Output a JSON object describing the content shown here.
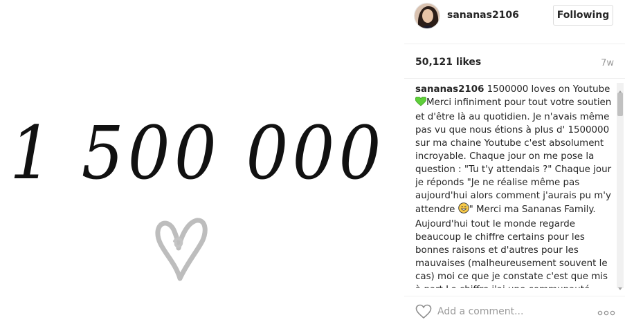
{
  "media": {
    "number_text": "1 500 000"
  },
  "header": {
    "username": "sananas2106",
    "follow_label": "Following"
  },
  "stats": {
    "likes": "50,121 likes",
    "age": "7w"
  },
  "caption": {
    "username": "sananas2106",
    "part1": " 1500000 loves on Youtube ",
    "part2": "Merci infiniment pour tout votre soutien et d'être là au quotidien. Je n'avais même pas vu que nous étions à plus d' 1500000 sur ma chaine Youtube c'est absolument incroyable. Chaque jour on me pose la question : \"Tu t'y attendais ?\" Chaque jour je réponds \"Je ne réalise même pas aujourd'hui alors comment j'aurais pu m'y attendre ",
    "part3": "\" Merci ma Sananas Family. Aujourd'hui tout le monde regarde beaucoup le chiffre certains pour les bonnes raisons et d'autres pour les mauvaises (malheureusement souvent le cas) moi ce que je constate c'est que mis à part Le chiffre j'ai une communauté"
  },
  "comment": {
    "placeholder": "Add a comment..."
  },
  "colors": {
    "green_heart": "#5fcf3a",
    "emoji_face": "#f7c948"
  }
}
